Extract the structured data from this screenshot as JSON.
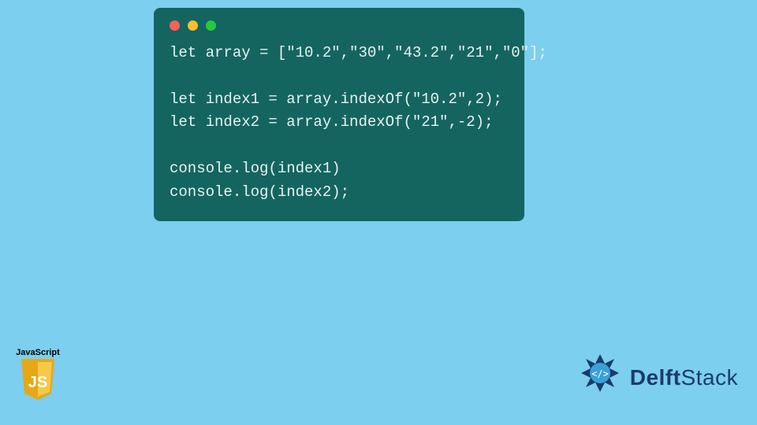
{
  "code": {
    "lines": [
      "let array = [\"10.2\",\"30\",\"43.2\",\"21\",\"0\"];",
      "",
      "let index1 = array.indexOf(\"10.2\",2);",
      "let index2 = array.indexOf(\"21\",-2);",
      "",
      "console.log(index1)",
      "console.log(index2);"
    ]
  },
  "window": {
    "dot_red": "#ff5f56",
    "dot_yellow": "#ffbd2e",
    "dot_green": "#27c93f",
    "bg": "#146560"
  },
  "js_badge": {
    "label": "JavaScript",
    "monogram": "JS"
  },
  "brand": {
    "name_bold": "Delft",
    "name_light": "Stack"
  }
}
